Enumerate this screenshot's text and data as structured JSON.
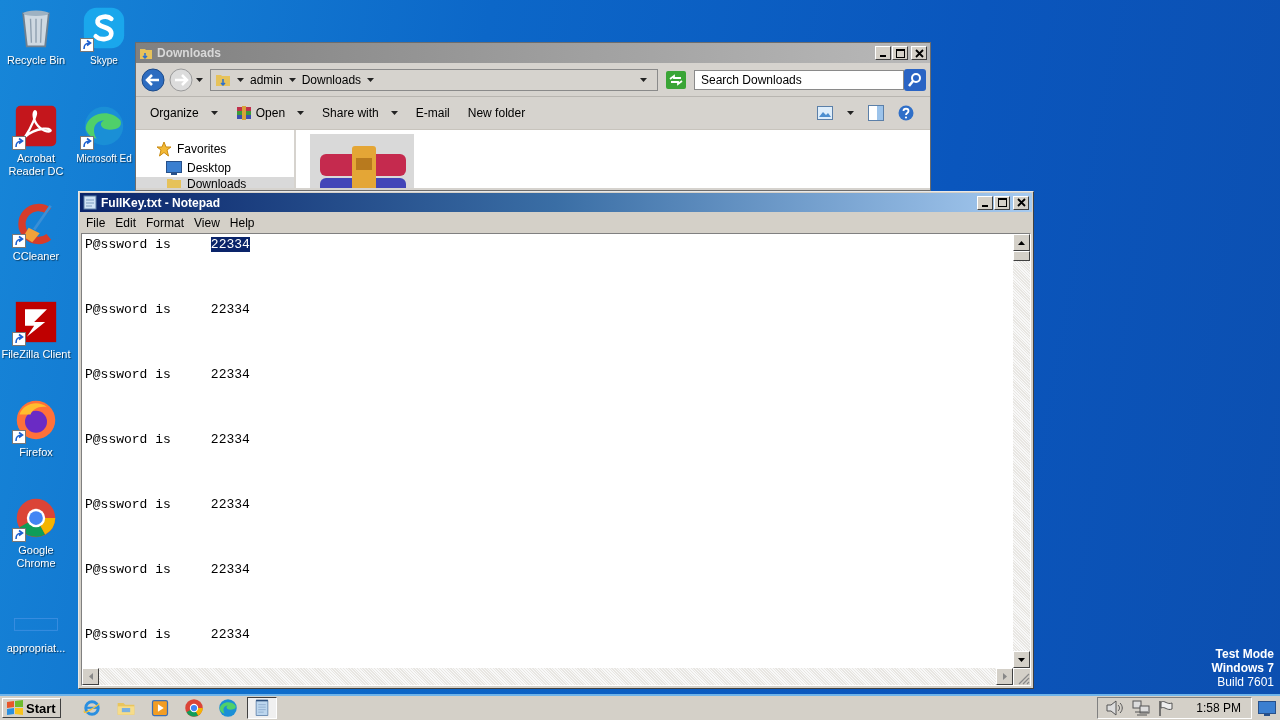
{
  "desktop": {
    "columns": [
      {
        "icons": [
          {
            "label": "Recycle Bin",
            "kind": "bin",
            "shortcut": false
          },
          {
            "label": "Acrobat Reader DC",
            "kind": "acrobat",
            "shortcut": true
          },
          {
            "label": "CCleaner",
            "kind": "ccleaner",
            "shortcut": true
          },
          {
            "label": "FileZilla Client",
            "kind": "filezilla",
            "shortcut": true
          },
          {
            "label": "Firefox",
            "kind": "firefox",
            "shortcut": true
          },
          {
            "label": "Google Chrome",
            "kind": "chrome",
            "shortcut": true
          },
          {
            "label": "appropriat...",
            "kind": "blank",
            "shortcut": false
          }
        ]
      },
      {
        "icons": [
          {
            "label": "Skype",
            "kind": "skype",
            "shortcut": true
          },
          {
            "label": "Microsoft Ed",
            "kind": "edge",
            "shortcut": true
          }
        ]
      }
    ],
    "system_text": [
      "Test Mode",
      "Windows 7",
      "Build 7601"
    ]
  },
  "explorer": {
    "title": "Downloads",
    "breadcrumb": [
      "admin",
      "Downloads"
    ],
    "search": {
      "placeholder": "Search Downloads"
    },
    "toolbar": [
      {
        "label": "Organize",
        "dropdown": true,
        "kind": "text"
      },
      {
        "label": "Open",
        "dropdown": true,
        "kind": "archive"
      },
      {
        "label": "Share with",
        "dropdown": true,
        "kind": "text"
      },
      {
        "label": "E-mail",
        "dropdown": false,
        "kind": "text"
      },
      {
        "label": "New folder",
        "dropdown": false,
        "kind": "text"
      }
    ],
    "nav": [
      {
        "label": "Favorites",
        "kind": "star",
        "selected": false
      },
      {
        "label": "Desktop",
        "kind": "desktop",
        "selected": false
      },
      {
        "label": "Downloads",
        "kind": "folder",
        "selected": true
      }
    ],
    "files": [
      {
        "kind": "archive",
        "selected": true
      }
    ]
  },
  "notepad": {
    "title": "FullKey.txt - Notepad",
    "menu": [
      "File",
      "Edit",
      "Format",
      "View",
      "Help"
    ],
    "lines": [
      {
        "text": "P@ssword is",
        "value": "22334",
        "selected": true
      },
      {
        "text": "P@ssword is",
        "value": "22334",
        "selected": false
      },
      {
        "text": "P@ssword is",
        "value": "22334",
        "selected": false
      },
      {
        "text": "P@ssword is",
        "value": "22334",
        "selected": false
      },
      {
        "text": "P@ssword is",
        "value": "22334",
        "selected": false
      },
      {
        "text": "P@ssword is",
        "value": "22334",
        "selected": false
      },
      {
        "text": "P@ssword is",
        "value": "22334",
        "selected": false
      }
    ]
  },
  "taskbar": {
    "start": "Start",
    "apps": [
      {
        "kind": "ie",
        "selected": false
      },
      {
        "kind": "explorer",
        "selected": false
      },
      {
        "kind": "media",
        "selected": false
      },
      {
        "kind": "chrome",
        "selected": false
      },
      {
        "kind": "edge",
        "selected": false
      },
      {
        "kind": "notepad",
        "selected": true
      }
    ],
    "clock": "1:58 PM"
  }
}
